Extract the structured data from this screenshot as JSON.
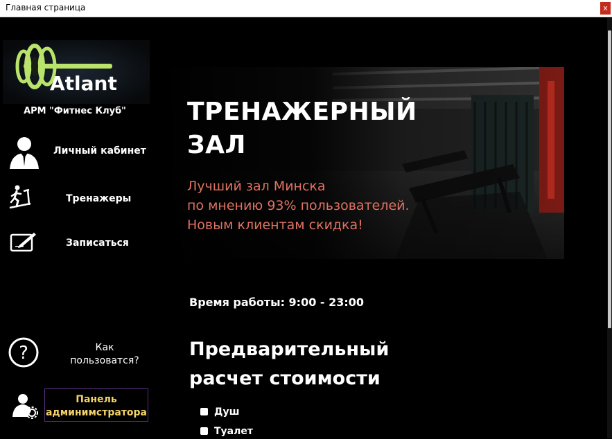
{
  "window": {
    "title": "Главная страница",
    "close_label": "x"
  },
  "sidebar": {
    "logo_text": "Atlant",
    "caption": "АРМ \"Фитнес Клуб\"",
    "items": [
      {
        "label": "Личный кабинет",
        "icon": "user-icon"
      },
      {
        "label": "Тренажеры",
        "icon": "treadmill-icon"
      },
      {
        "label": "Записаться",
        "icon": "signup-icon"
      },
      {
        "label": "Как\nпользоватся?",
        "icon": "help-icon"
      }
    ],
    "admin_button": "Панель\nадминимстратора",
    "admin_icon": "admin-settings-icon"
  },
  "banner": {
    "title": "ТРЕНАЖЕРНЫЙ\nЗАЛ",
    "subtitle": "Лучший зал Минска\nпо мнению 93% пользователей.\nНовым клиентам скидка!"
  },
  "hours": "Время работы: 9:00 - 23:00",
  "calc": {
    "heading": "Предварительный\nрасчет стоимости",
    "options": [
      {
        "label": "Душ",
        "checked": false
      },
      {
        "label": "Туалет",
        "checked": false
      }
    ]
  },
  "colors": {
    "accent_yellow": "#f4d36a",
    "banner_subtitle": "#e07263",
    "admin_border": "#5a2f86",
    "logo_green": "#b9e36a"
  }
}
